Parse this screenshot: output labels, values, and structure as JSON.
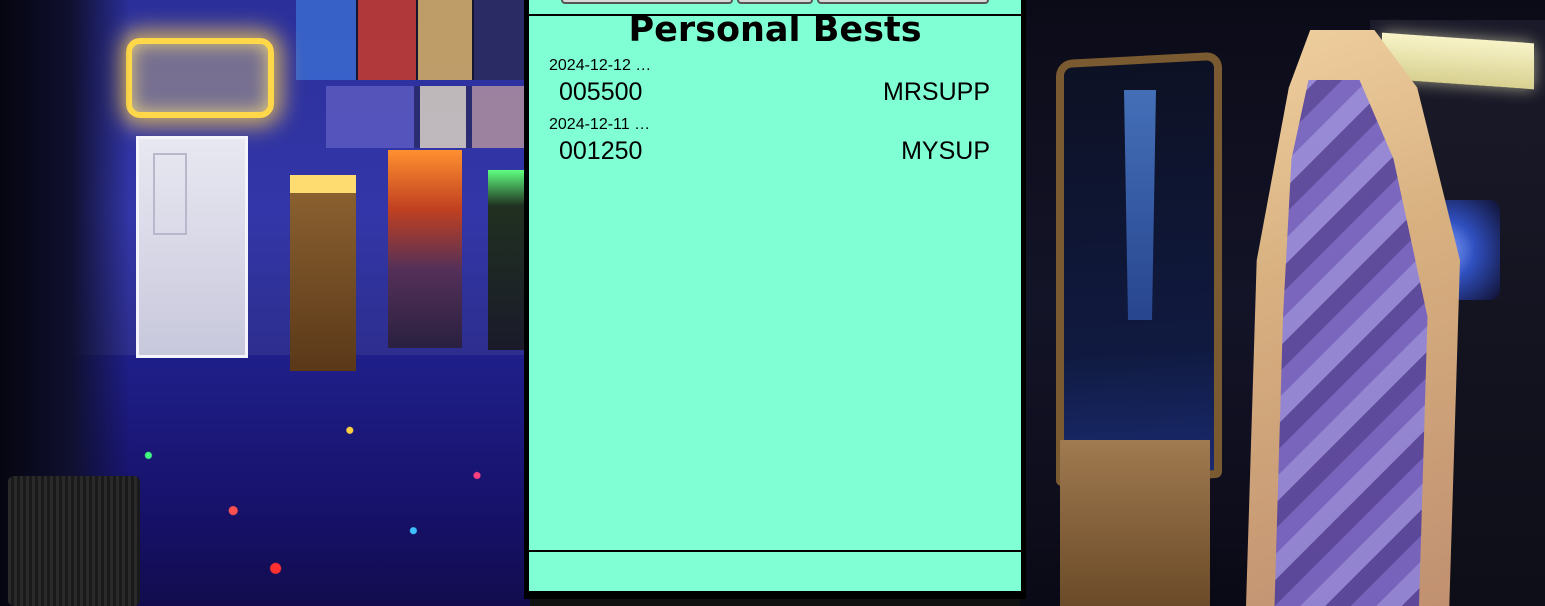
{
  "panel": {
    "title": "Personal Bests",
    "background_color": "#80ffd4",
    "entries": [
      {
        "date": "2024-12-12 …",
        "score": "005500",
        "name": "MRSUPP"
      },
      {
        "date": "2024-12-11 …",
        "score": "001250",
        "name": "MYSUP"
      }
    ]
  },
  "background": {
    "description_colors": {
      "wall": "#3336a8",
      "neon_sign": "#ffd84a"
    }
  }
}
